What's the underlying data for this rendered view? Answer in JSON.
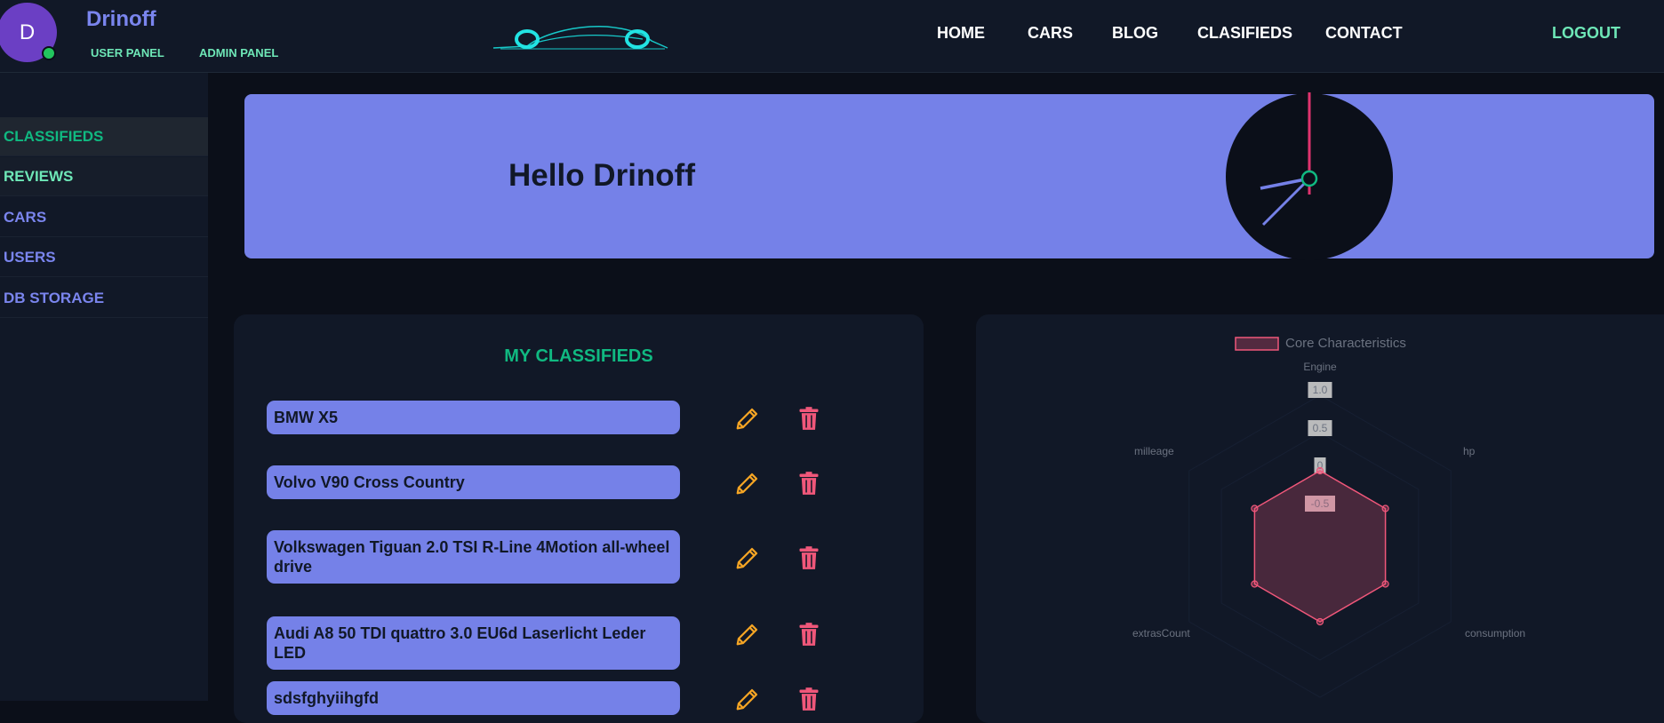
{
  "header": {
    "avatar_letter": "D",
    "username": "Drinoff",
    "user_panel": "USER PANEL",
    "admin_panel": "ADMIN PANEL",
    "nav": [
      "HOME",
      "CARS",
      "BLOG",
      "CLASIFIEDS",
      "CONTACT"
    ],
    "logout": "LOGOUT"
  },
  "sidebar": {
    "items": [
      {
        "label": "CLASSIFIEDS",
        "color": "#10b981"
      },
      {
        "label": "REVIEWS",
        "color": "#6ee7b7"
      },
      {
        "label": "CARS",
        "color": "#7a85ee"
      },
      {
        "label": "USERS",
        "color": "#7a85ee"
      },
      {
        "label": "DB STORAGE",
        "color": "#7a85ee"
      }
    ]
  },
  "banner": {
    "greeting": "Hello Drinoff",
    "clock": {
      "hour_hand": "ninth hour",
      "minute_hand": "clock-icon"
    }
  },
  "classifieds": {
    "title": "MY CLASSIFIEDS",
    "items": [
      "BMW X5",
      "Volvo V90 Cross Country",
      "Volkswagen Tiguan 2.0 TSI R-Line 4Motion all-wheel drive",
      "Audi A8 50 TDI quattro 3.0 EU6d Laserlicht Leder LED",
      "sdsfghyiihgfd"
    ],
    "edit_icon": "pencil-icon",
    "delete_icon": "trash-icon"
  },
  "chart_data": {
    "type": "radar",
    "legend": "Core Characteristics",
    "legend_position": "top",
    "axes": [
      "Engine",
      "hp",
      "consumption",
      "extrasCount",
      "milleage"
    ],
    "axis_order_note_visible": [
      "Engine",
      "hp",
      "consumption",
      "",
      "extrasCount",
      "milleage"
    ],
    "ticks": [
      "1.0",
      "0.5",
      "0",
      "-0.5"
    ],
    "range": [
      -1,
      1
    ],
    "series": [
      {
        "name": "Core Characteristics",
        "values": [
          0,
          0,
          0,
          0,
          0,
          0
        ]
      }
    ],
    "colors": {
      "line": "#f0577a",
      "fill": "rgba(240,87,122,0.25)"
    }
  }
}
